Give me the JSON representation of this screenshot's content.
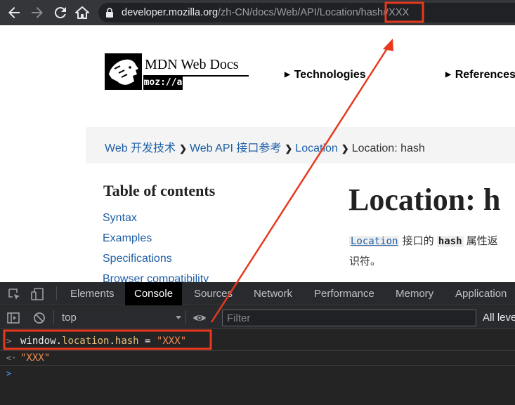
{
  "browser": {
    "url_host": "developer.mozilla.org",
    "url_path": "/zh-CN/docs/Web/API/Location/hash",
    "url_hash": "#XXX"
  },
  "header": {
    "logo_title": "MDN Web Docs",
    "logo_sub": "moz://a",
    "nav": [
      "Technologies",
      "References"
    ]
  },
  "breadcrumb": {
    "items": [
      "Web 开发技术",
      "Web API 接口参考",
      "Location"
    ],
    "current": "Location: hash"
  },
  "toc": {
    "title": "Table of contents",
    "links": [
      "Syntax",
      "Examples",
      "Specifications",
      "Browser compatibility"
    ]
  },
  "article": {
    "title": "Location: h",
    "desc_link": "Location",
    "desc_mid": " 接口的 ",
    "desc_code": "hash",
    "desc_tail": " 属性返",
    "desc_line2": "识符。"
  },
  "devtools": {
    "tabs": [
      "Elements",
      "Console",
      "Sources",
      "Network",
      "Performance",
      "Memory",
      "Application"
    ],
    "active_tab": "Console",
    "context": "top",
    "filter_placeholder": "Filter",
    "levels": "All leve",
    "console_input": {
      "prompt": ">",
      "parts": [
        "window",
        ".",
        "location",
        ".",
        "hash",
        " = ",
        "\"XXX\""
      ]
    },
    "console_output": {
      "prompt": "<·",
      "value": "\"XXX\""
    },
    "empty_prompt": ">"
  },
  "annotation": {
    "color": "#e8391e"
  }
}
